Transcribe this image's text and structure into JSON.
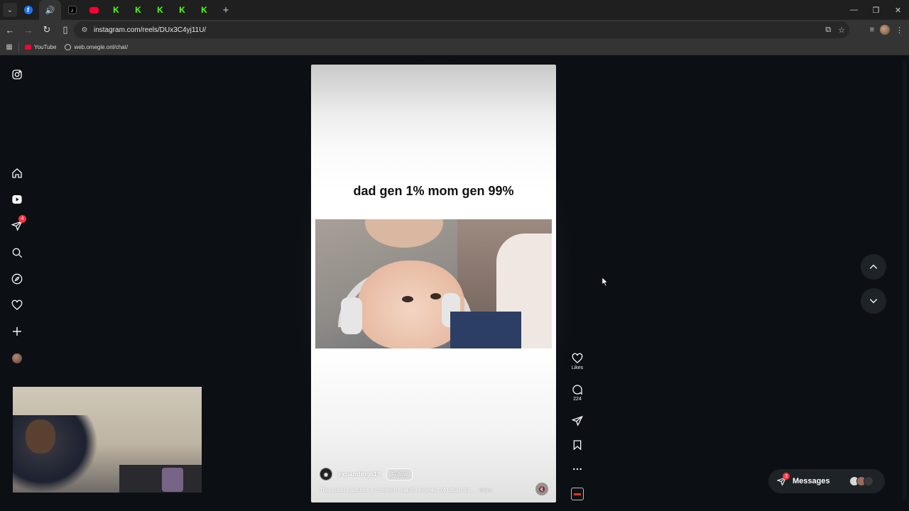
{
  "browser": {
    "tabs": [
      {
        "icon": "facebook-icon",
        "active": false
      },
      {
        "icon": "speaker-icon",
        "active": true
      },
      {
        "icon": "tiktok-icon",
        "active": false
      },
      {
        "icon": "youtube-icon",
        "active": false
      },
      {
        "icon": "kick-icon",
        "active": false
      },
      {
        "icon": "kick-icon",
        "active": false
      },
      {
        "icon": "kick-icon",
        "active": false
      },
      {
        "icon": "kick-icon",
        "active": false
      },
      {
        "icon": "kick-icon",
        "active": false
      }
    ],
    "url": "instagram.com/reels/DUx3C4yj11U/",
    "bookmarks": [
      {
        "label": "YouTube",
        "icon": "youtube-icon"
      },
      {
        "label": "web.omegle.onl/chat/",
        "icon": "globe-icon"
      }
    ]
  },
  "sidebar": {
    "notifications_badge": "4",
    "items": [
      "instagram-logo",
      "home",
      "reels",
      "direct",
      "search",
      "explore",
      "notifications",
      "create",
      "profile"
    ]
  },
  "reel": {
    "overlay_text": "dad gen 1% mom gen 99%",
    "author": "expanding619",
    "follow_label": "Follow",
    "description": "This video captures a common real-life moment of urban tra ...",
    "more_label": "more"
  },
  "actions": {
    "likes_label": "Likes",
    "comments_count": "224"
  },
  "messages": {
    "label": "Messages",
    "badge": "3"
  },
  "colors": {
    "background": "#0c1014",
    "badge_red": "#ff3040",
    "kick_green": "#53fc18",
    "chrome_dark": "#1f1f1f"
  }
}
